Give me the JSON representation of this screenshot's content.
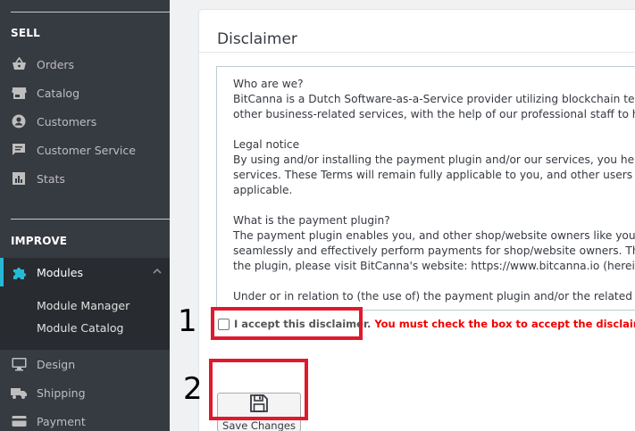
{
  "sidebar": {
    "section_sell": "SELL",
    "sell_items": [
      {
        "label": "Orders",
        "icon": "basket-icon"
      },
      {
        "label": "Catalog",
        "icon": "store-icon"
      },
      {
        "label": "Customers",
        "icon": "account-circle-icon"
      },
      {
        "label": "Customer Service",
        "icon": "chat-icon"
      },
      {
        "label": "Stats",
        "icon": "bar-chart-icon"
      }
    ],
    "section_improve": "IMPROVE",
    "modules": {
      "label": "Modules",
      "icon": "puzzle-icon",
      "expanded": true
    },
    "modules_sub": [
      "Module Manager",
      "Module Catalog"
    ],
    "improve_items": [
      {
        "label": "Design",
        "icon": "monitor-icon"
      },
      {
        "label": "Shipping",
        "icon": "truck-icon"
      },
      {
        "label": "Payment",
        "icon": "credit-card-icon"
      }
    ]
  },
  "panel": {
    "title": "Disclaimer",
    "paragraphs": [
      [
        "Who are we?",
        "BitCanna is a Dutch Software-as-a-Service provider utilizing blockchain technolog",
        "other business-related services, with the help of our professional staff to help me"
      ],
      [
        "Legal notice",
        "By using and/or installing the payment plugin and/or our services, you hereby ag",
        "services. These Terms will remain fully applicable to you, and other users of the p",
        "applicable."
      ],
      [
        "What is the payment plugin?",
        "The payment plugin enables you, and other shop/website owners like you, to allo",
        "seamlessly and effectively perform payments for shop/website owners. The plugi",
        "the plugin, please visit BitCanna's website: https://www.bitcanna.io (hereinafter re"
      ],
      [
        "Under or in relation to (the use of) the payment plugin and/or the related service"
      ]
    ],
    "accept_label": "I accept this disclaimer.",
    "accept_checked": false,
    "accept_warning": "You must check the box to accept the disclaimer.",
    "save_label": "Save Changes",
    "save_icon": "floppy-disk-icon"
  },
  "annotations": {
    "step1": "1",
    "step2": "2"
  },
  "colors": {
    "sidebar_bg": "#363a41",
    "sidebar_active_bg": "#282b30",
    "accent": "#25b9d7",
    "warning": "#f00000",
    "highlight": "#e0192c"
  }
}
